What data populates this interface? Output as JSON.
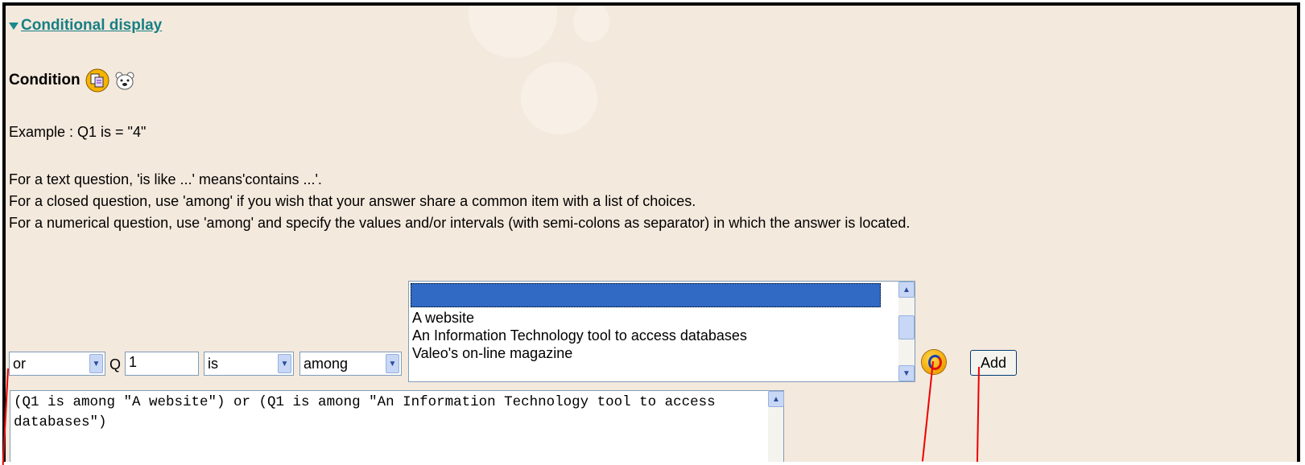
{
  "section": {
    "title": "Conditional display"
  },
  "condition": {
    "label": "Condition",
    "icons": [
      "question-list-icon",
      "bear-help-icon"
    ]
  },
  "help": {
    "example": "Example : Q1 is = \"4\"",
    "lines": [
      "For a text question, 'is like ...' means'contains ...'.",
      "For a closed question, use 'among' if you wish that your answer share a common item with a list of choices.",
      "For a numerical question, use 'among' and specify the values and/or intervals (with semi-colons as separator) in which the answer is located."
    ]
  },
  "builder": {
    "connector": "or",
    "question_prefix": "Q",
    "question_number": "1",
    "operator": "is",
    "comparison": "among",
    "answers": [
      "",
      "A website",
      "An Information Technology tool to access databases",
      "Valeo's on-line magazine"
    ],
    "selected_answer_index": 0,
    "add_label": "Add"
  },
  "condition_text": "(Q1 is among \"A website\") or (Q1 is among \"An Information Technology tool to access databases\")",
  "colors": {
    "background": "#f4e9dd",
    "link": "#177f83",
    "selection": "#316ac5",
    "callout": "#e00000"
  }
}
